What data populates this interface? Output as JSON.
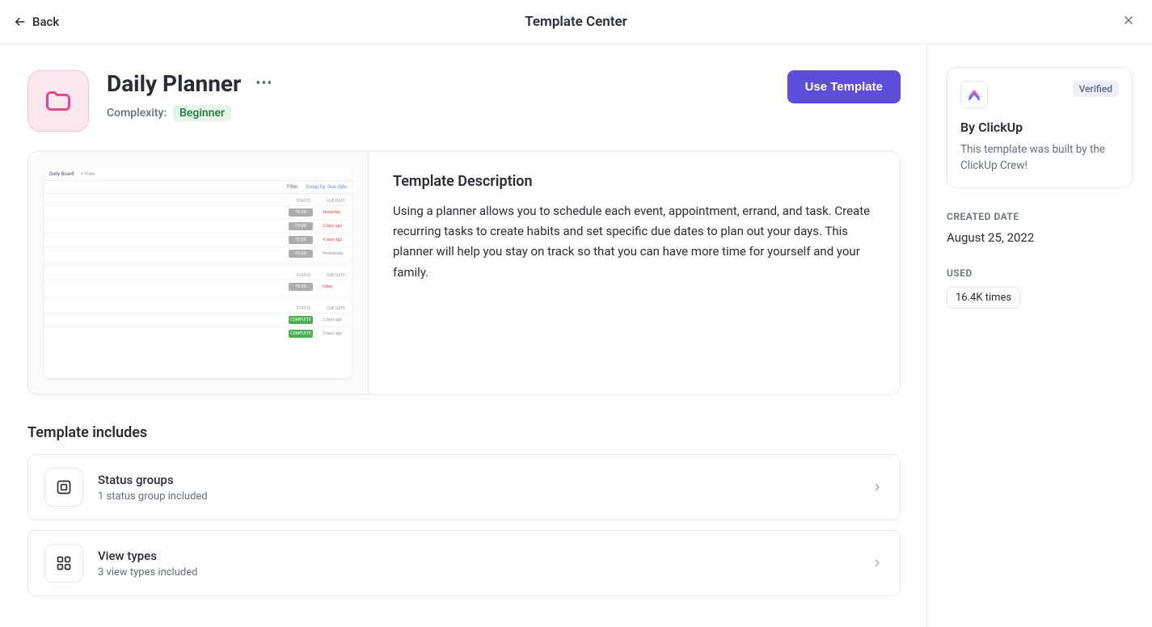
{
  "header": {
    "back_label": "Back",
    "title": "Template Center"
  },
  "template": {
    "title": "Daily Planner",
    "complexity_label": "Complexity:",
    "complexity_value": "Beginner",
    "use_button": "Use Template",
    "description_heading": "Template Description",
    "description_body": "Using a planner allows you to schedule each event, appointment, errand, and task. Create recurring tasks to create habits and set specific due dates to plan out your days. This planner will help you stay on track so that you can have more time for yourself and your family."
  },
  "preview": {
    "tab": "Daily Board",
    "add_view": "+ View",
    "filter": "Filter",
    "group_label": "Group by: Due date",
    "col_status": "STATUS",
    "col_due": "DUE DATE",
    "rows1": [
      {
        "status": "TO DO",
        "status_class": "todo",
        "due": "Yesterday",
        "due_class": "red"
      },
      {
        "status": "TO DO",
        "status_class": "todo",
        "due": "2 days ago",
        "due_class": "red"
      },
      {
        "status": "TO DO",
        "status_class": "todo",
        "due": "4 days ago",
        "due_class": "red"
      },
      {
        "status": "TO DO",
        "status_class": "todo",
        "due": "Wednesday",
        "due_class": "gray"
      }
    ],
    "rows2": [
      {
        "status": "TO DO",
        "status_class": "todo",
        "due": "today",
        "due_class": "red"
      }
    ],
    "rows3": [
      {
        "status": "COMPLETE",
        "status_class": "complete",
        "due": "2 days ago",
        "due_class": "gray"
      },
      {
        "status": "COMPLETE",
        "status_class": "complete",
        "due": "3 days ago",
        "due_class": "gray"
      }
    ]
  },
  "includes": {
    "heading": "Template includes",
    "items": [
      {
        "icon": "status",
        "name": "Status groups",
        "sub": "1 status group included"
      },
      {
        "icon": "grid",
        "name": "View types",
        "sub": "3 view types included"
      }
    ]
  },
  "sidebar": {
    "verified": "Verified",
    "author": "By ClickUp",
    "author_desc": "This template was built by the ClickUp Crew!",
    "created_label": "CREATED DATE",
    "created_value": "August 25, 2022",
    "used_label": "USED",
    "used_value": "16.4K times"
  }
}
